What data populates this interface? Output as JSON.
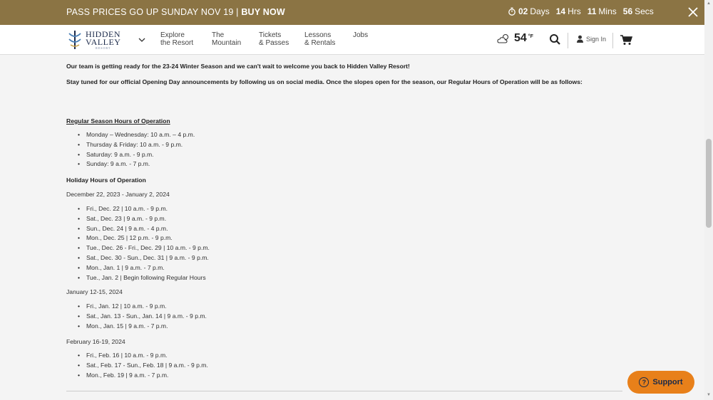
{
  "promo": {
    "text": "PASS PRICES GO UP SUNDAY NOV 19 |",
    "cta": "BUY NOW",
    "countdown": [
      {
        "num": "02",
        "unit": "Days"
      },
      {
        "num": "14",
        "unit": "Hrs"
      },
      {
        "num": "11",
        "unit": "Mins"
      },
      {
        "num": "56",
        "unit": "Secs"
      }
    ]
  },
  "nav": {
    "logo_line1": "HIDDEN",
    "logo_line2": "VALLEY",
    "logo_line3": "RESORT",
    "links": [
      {
        "line1": "Explore",
        "line2": "the Resort"
      },
      {
        "line1": "The",
        "line2": "Mountain"
      },
      {
        "line1": "Tickets",
        "line2": "& Passes"
      },
      {
        "line1": "Lessons",
        "line2": "& Rentals"
      },
      {
        "line1": "Jobs",
        "line2": ""
      }
    ],
    "temperature": "54",
    "temp_unit": "°F",
    "signin": "Sign In"
  },
  "content": {
    "intro": "Our team is getting ready for the 23-24 Winter Season and we can't wait to welcome you back to Hidden Valley Resort!",
    "stay_tuned": "Stay tuned for our official Opening Day announcements by following us on social media. Once the slopes open for the season, our Regular Hours of Operation will be as follows:",
    "regular_heading": "Regular Season Hours of Operation",
    "regular_hours": [
      "Monday – Wednesday: 10 a.m. – 4 p.m.",
      "Thursday & Friday: 10 a.m. - 9 p.m.",
      "Saturday: 9 a.m. - 9 p.m.",
      "Sunday: 9 a.m. - 7 p.m."
    ],
    "holiday_heading": "Holiday Hours of Operation",
    "range1": "December 22, 2023 - January 2, 2024",
    "holiday1": [
      "Fri., Dec. 22 | 10 a.m. - 9 p.m.",
      "Sat., Dec. 23 | 9 a.m. - 9 p.m.",
      "Sun., Dec. 24 | 9 a.m. - 4 p.m.",
      "Mon., Dec. 25 | 12 p.m. - 9 p.m.",
      "Tue., Dec. 26 - Fri., Dec. 29 | 10 a.m. - 9 p.m.",
      "Sat., Dec. 30 - Sun., Dec. 31 | 9 a.m. - 9 p.m.",
      "Mon., Jan. 1 | 9 a.m. - 7 p.m.",
      "Tue., Jan. 2 | Begin following Regular Hours"
    ],
    "range2": "January 12-15, 2024",
    "holiday2": [
      "Fri., Jan. 12 | 10 a.m. - 9 p.m.",
      "Sat., Jan. 13 - Sun., Jan. 14 | 9 a.m. - 9 p.m.",
      "Mon., Jan. 15 |  9 a.m. - 7 p.m."
    ],
    "range3": "February 16-19, 2024",
    "holiday3": [
      "Fri., Feb. 16 | 10 a.m. - 9 p.m.",
      "Sat., Feb. 17 - Sun., Feb. 18 | 9 a.m. - 9 p.m.",
      "Mon., Feb. 19 |  9 a.m. - 7 p.m."
    ]
  },
  "support": {
    "label": "Support"
  },
  "colors": {
    "promo_bg": "#8b7444",
    "support_bg": "#e8801a",
    "navy": "#1c2a4a"
  },
  "icons": [
    "stopwatch-icon",
    "close-icon",
    "chevron-down-icon",
    "partly-cloudy-icon",
    "search-icon",
    "user-icon",
    "cart-icon",
    "question-icon"
  ]
}
